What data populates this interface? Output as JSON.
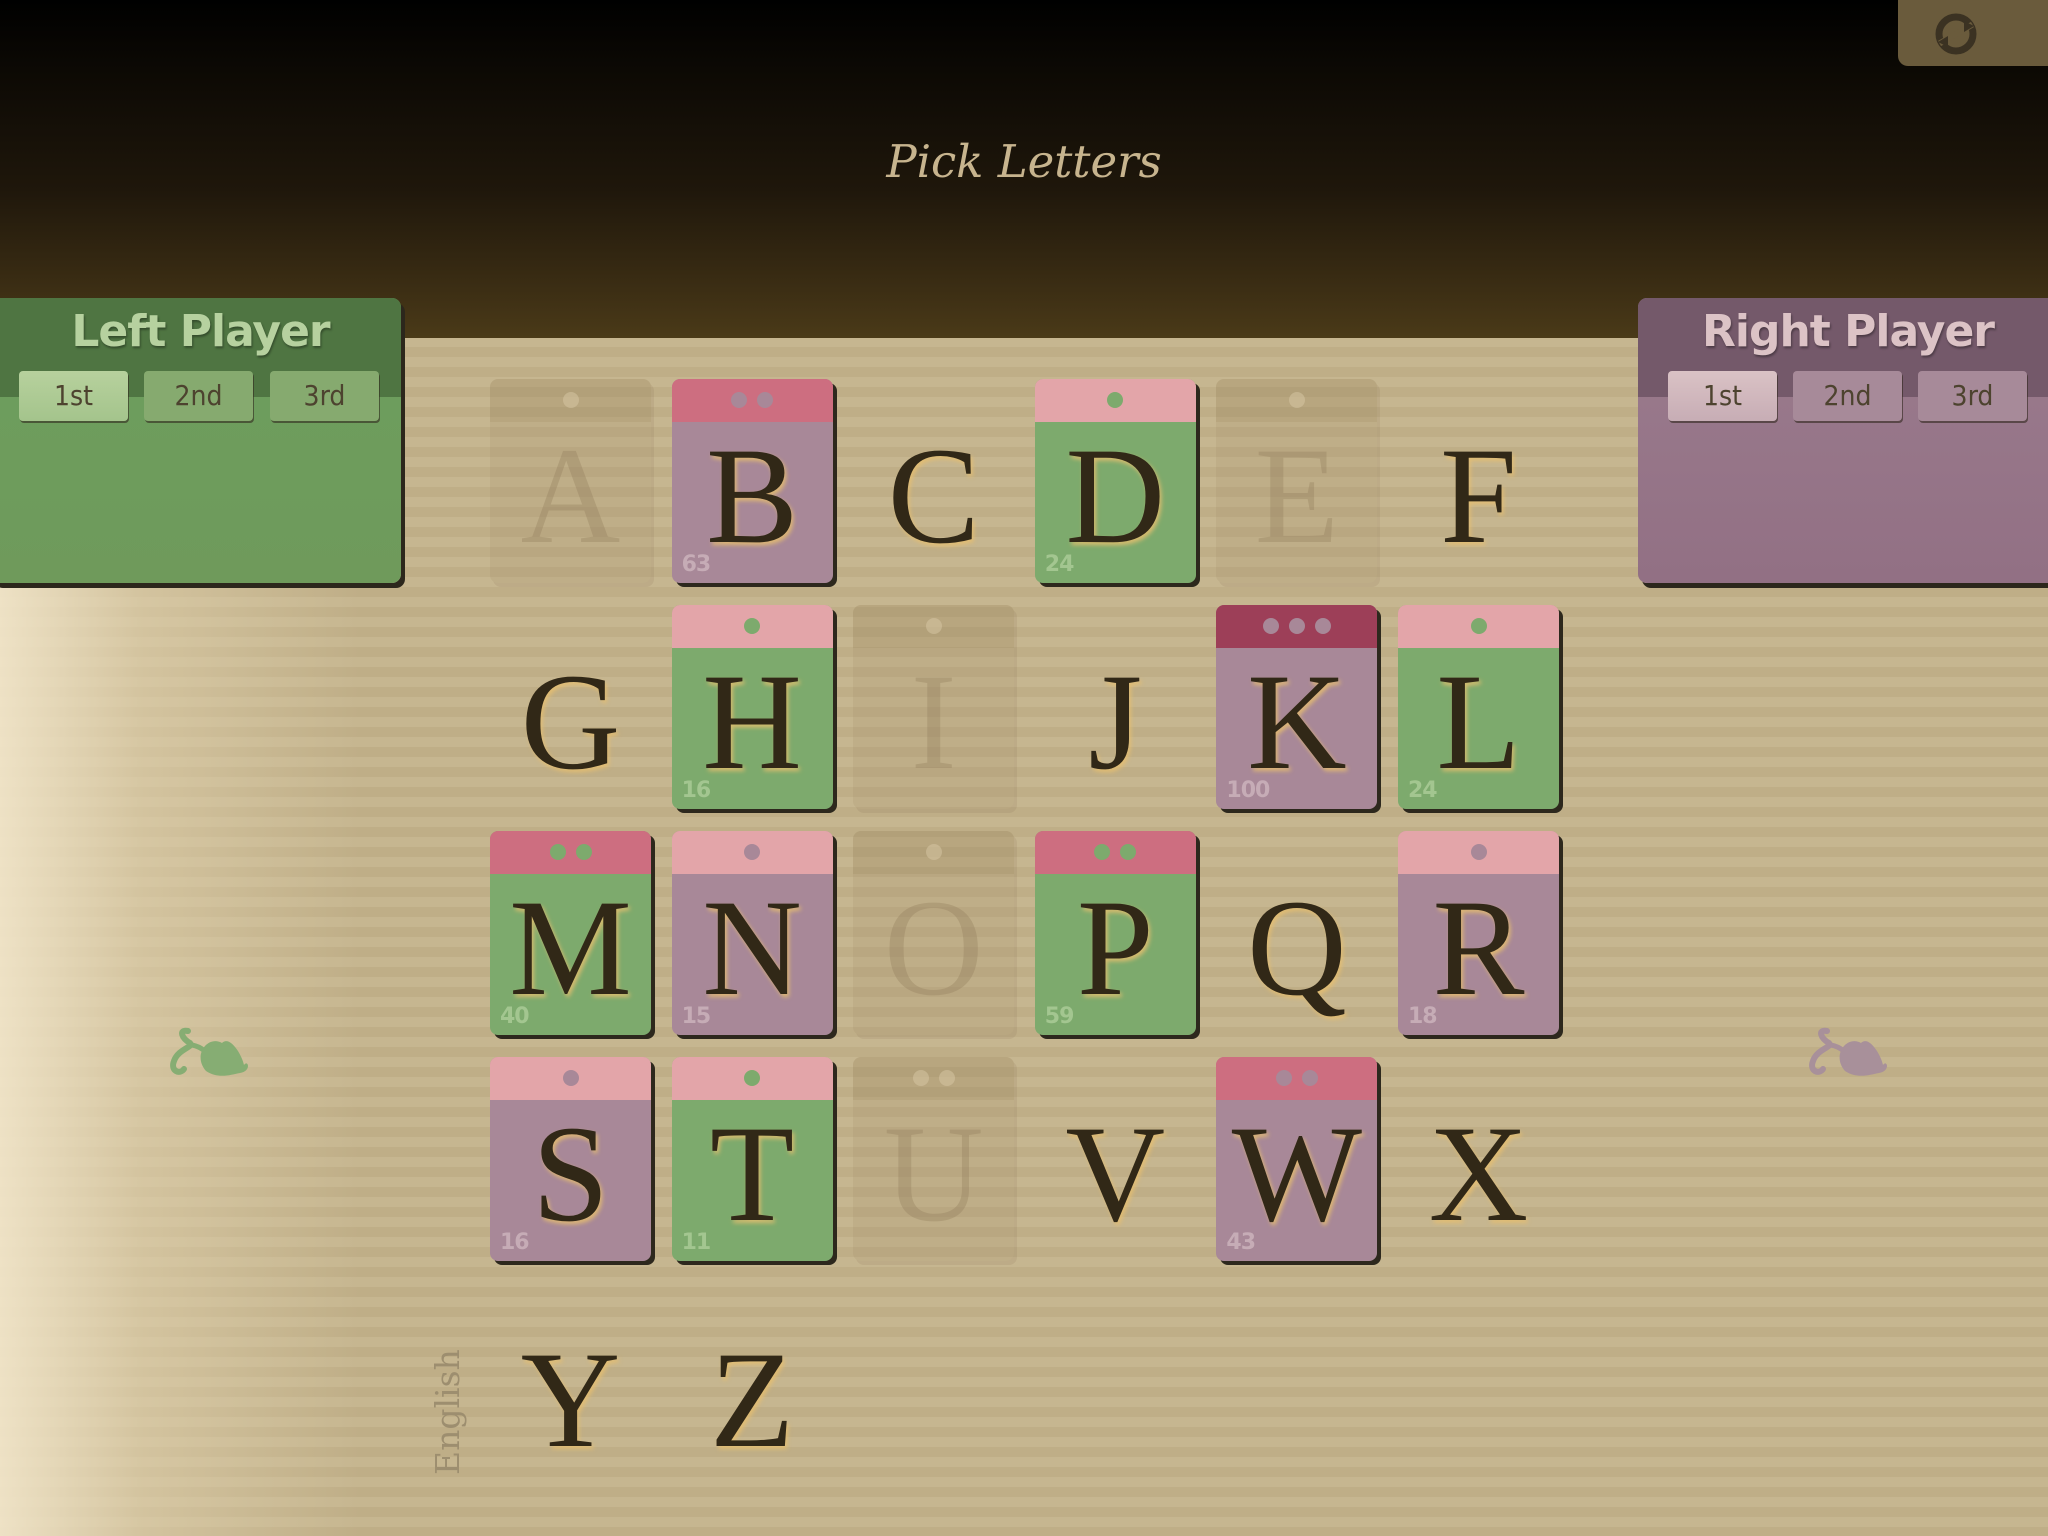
{
  "header": {
    "title": "Pick Letters",
    "refresh_icon": "refresh-icon"
  },
  "players": {
    "left": {
      "name": "Left Player",
      "color": "#6c9f5e",
      "ranks": [
        "1st",
        "2nd",
        "3rd"
      ],
      "selected_rank": "1st"
    },
    "right": {
      "name": "Right Player",
      "color": "#9b7c8e",
      "ranks": [
        "1st",
        "2nd",
        "3rd"
      ],
      "selected_rank": "1st"
    }
  },
  "colors": {
    "green_tile": "#7daa6d",
    "mauve_tile": "#a88898",
    "band_light": "#e3a5a9",
    "band_medium": "#cd6e80",
    "band_dark": "#9d3f58",
    "dot_green": "#7daa6d",
    "dot_mauve": "#a88898"
  },
  "language": "English",
  "letters": [
    {
      "letter": "A",
      "state": "used",
      "dots": 1
    },
    {
      "letter": "B",
      "state": "mauve",
      "dots": 2,
      "count": "63"
    },
    {
      "letter": "C",
      "state": "free"
    },
    {
      "letter": "D",
      "state": "green",
      "dots": 1,
      "count": "24"
    },
    {
      "letter": "E",
      "state": "used",
      "dots": 1
    },
    {
      "letter": "F",
      "state": "free"
    },
    {
      "letter": "G",
      "state": "free"
    },
    {
      "letter": "H",
      "state": "green",
      "dots": 1,
      "count": "16"
    },
    {
      "letter": "I",
      "state": "used",
      "dots": 1
    },
    {
      "letter": "J",
      "state": "free"
    },
    {
      "letter": "K",
      "state": "mauve",
      "dots": 3,
      "count": "100"
    },
    {
      "letter": "L",
      "state": "green",
      "dots": 1,
      "count": "24"
    },
    {
      "letter": "M",
      "state": "green",
      "dots": 2,
      "count": "40"
    },
    {
      "letter": "N",
      "state": "mauve",
      "dots": 1,
      "count": "15"
    },
    {
      "letter": "O",
      "state": "used",
      "dots": 1
    },
    {
      "letter": "P",
      "state": "green",
      "dots": 2,
      "count": "59"
    },
    {
      "letter": "Q",
      "state": "free"
    },
    {
      "letter": "R",
      "state": "mauve",
      "dots": 1,
      "count": "18"
    },
    {
      "letter": "S",
      "state": "mauve",
      "dots": 1,
      "count": "16"
    },
    {
      "letter": "T",
      "state": "green",
      "dots": 1,
      "count": "11"
    },
    {
      "letter": "U",
      "state": "used",
      "dots": 2
    },
    {
      "letter": "V",
      "state": "free"
    },
    {
      "letter": "W",
      "state": "mauve",
      "dots": 2,
      "count": "43"
    },
    {
      "letter": "X",
      "state": "free"
    },
    {
      "letter": "Y",
      "state": "free"
    },
    {
      "letter": "Z",
      "state": "free"
    }
  ]
}
